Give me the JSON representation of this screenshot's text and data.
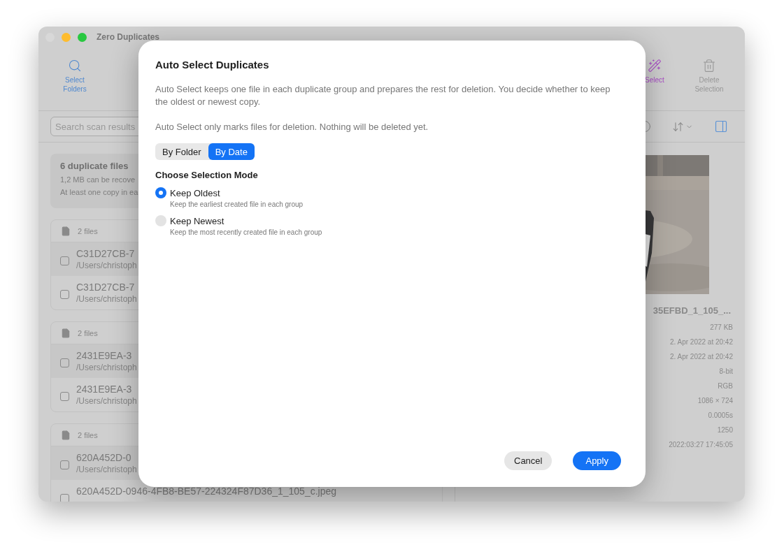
{
  "window": {
    "title": "Zero Duplicates"
  },
  "toolbar": [
    {
      "label": "Select Folders",
      "kind": "search",
      "disabled": false
    },
    {
      "label": "Select",
      "kind": "wand",
      "disabled": false
    },
    {
      "label": "Delete Selection",
      "kind": "trash",
      "disabled": true
    }
  ],
  "search": {
    "placeholder": "Search scan results"
  },
  "summary": {
    "title": "6 duplicate files",
    "lines": [
      "1,2 MB can be recove",
      "At least one copy in ea"
    ]
  },
  "groups": [
    {
      "count": "2 files",
      "files": [
        {
          "name": "C31D27CB-7",
          "path": "/Users/christoph",
          "checked": false
        },
        {
          "name": "C31D27CB-7",
          "path": "/Users/christoph",
          "checked": false
        }
      ]
    },
    {
      "count": "2 files",
      "files": [
        {
          "name": "2431E9EA-3",
          "path": "/Users/christoph",
          "checked": false
        },
        {
          "name": "2431E9EA-3",
          "path": "/Users/christoph",
          "checked": false
        }
      ]
    },
    {
      "count": "2 files",
      "files": [
        {
          "name": "620A452D-0",
          "path": "/Users/christoph",
          "checked": false
        },
        {
          "name": "620A452D-0946-4FB8-BE57-224324F87D36_1_105_c.jpeg",
          "checked": false
        }
      ]
    }
  ],
  "preview": {
    "filename": "35EFBD_1_105_...",
    "details": [
      "277 KB",
      "2. Apr 2022 at 20:42",
      "2. Apr 2022 at 20:42",
      "8-bit",
      "RGB",
      "1086 × 724",
      "0.0005s",
      "1250",
      "2022:03:27 17:45:05"
    ]
  },
  "dialog": {
    "title": "Auto Select Duplicates",
    "paragraphs": [
      "Auto Select keeps one file in each duplicate group and prepares the rest for deletion. You decide whether to keep the oldest or newest copy.",
      "Auto Select only marks files for deletion. Nothing will be deleted yet."
    ],
    "segments": [
      {
        "label": "By Folder",
        "selected": false
      },
      {
        "label": "By Date",
        "selected": true
      }
    ],
    "section_title": "Choose Selection Mode",
    "options": [
      {
        "label": "Keep Oldest",
        "hint": "Keep the earliest created file in each group",
        "selected": true
      },
      {
        "label": "Keep Newest",
        "hint": "Keep the most recently created file in each group",
        "selected": false
      }
    ],
    "buttons": [
      {
        "label": "Cancel",
        "kind": "secondary"
      },
      {
        "label": "Apply",
        "kind": "primary"
      }
    ]
  }
}
